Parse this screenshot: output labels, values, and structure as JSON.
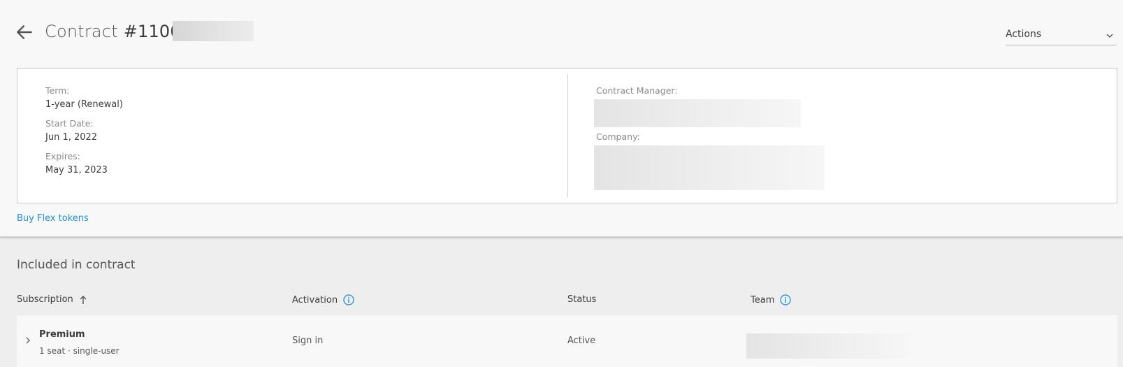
{
  "header": {
    "title_prefix": "Contract",
    "contract_number": "#11000",
    "actions_label": "Actions"
  },
  "details": {
    "term_label": "Term:",
    "term_value": "1-year (Renewal)",
    "start_label": "Start Date:",
    "start_value": "Jun 1, 2022",
    "expires_label": "Expires:",
    "expires_value": "May 31, 2023",
    "manager_label": "Contract Manager:",
    "company_label": "Company:"
  },
  "links": {
    "buy_flex": "Buy Flex tokens"
  },
  "included": {
    "title": "Included in contract",
    "columns": {
      "subscription": "Subscription",
      "activation": "Activation",
      "status": "Status",
      "team": "Team"
    },
    "rows": [
      {
        "name": "Premium",
        "detail": "1 seat · single-user",
        "activation": "Sign in",
        "status": "Active"
      }
    ]
  },
  "colors": {
    "link": "#1f8fd6",
    "panel": "#f8f8f8",
    "background": "#eeeeee"
  },
  "icons": [
    "back-arrow-icon",
    "chevron-down-icon",
    "sort-ascending-icon",
    "info-icon",
    "chevron-right-icon"
  ]
}
